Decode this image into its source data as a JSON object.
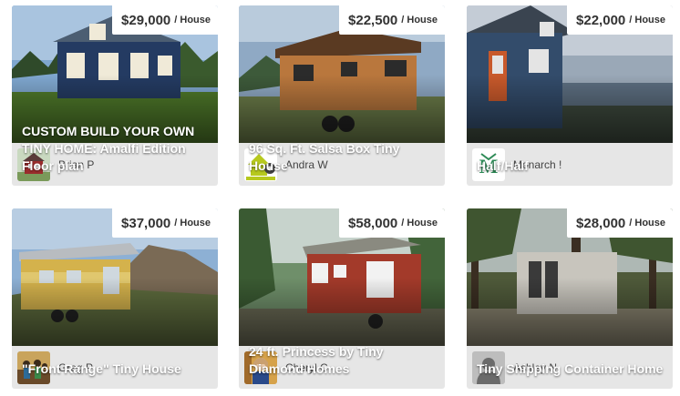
{
  "listings": [
    {
      "title": "CUSTOM BUILD YOUR OWN TINY HOME: Amalfi Edition Floor plan",
      "price": "$29,000",
      "unit": "/ House",
      "owner": "Brian P",
      "photo": "navy-cottage-photo"
    },
    {
      "title": "96 Sq. Ft. Salsa Box Tiny House",
      "price": "$22,500",
      "unit": "/ House",
      "owner": "Andra W",
      "photo": "cedar-tiny-house-photo"
    },
    {
      "title": "Half/Half",
      "price": "$22,000",
      "unit": "/ House",
      "owner": "Monarch !",
      "photo": "blue-house-ocean-photo"
    },
    {
      "title": "\"Front Range\" Tiny House",
      "price": "$37,000",
      "unit": "/ House",
      "owner": "Greg P",
      "photo": "yellow-tiny-house-mountain-photo"
    },
    {
      "title": "24 ft. Princess by Tiny Diamond Homes",
      "price": "$58,000",
      "unit": "/ House",
      "owner": "Cheryl C",
      "photo": "red-tiny-house-forest-photo"
    },
    {
      "title": "Tiny Shipping Container Home",
      "price": "$28,000",
      "unit": "/ House",
      "owner": "Ashley N",
      "photo": "container-home-forest-photo"
    }
  ],
  "avatars": [
    "red-house-avatar",
    "shelter-logo-avatar",
    "monarch-logo-avatar",
    "family-photo-avatar",
    "woman-photo-avatar",
    "default-user-avatar"
  ],
  "avatar_logo_letter": "M",
  "colors": {
    "card_bg": "#e6e6e6",
    "price_text": "#333333",
    "title_text": "#ffffff",
    "monarch_green": "#2e8b57"
  }
}
